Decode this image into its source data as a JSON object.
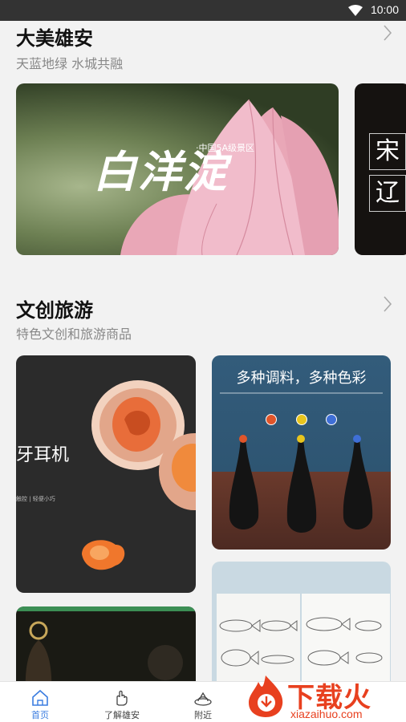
{
  "status_bar": {
    "time": "10:00"
  },
  "sections": {
    "beauty": {
      "title": "大美雄安",
      "subtitle": "天蓝地绿 水城共融"
    },
    "culture": {
      "title": "文创旅游",
      "subtitle": "特色文创和旅游商品"
    }
  },
  "lotus_card": {
    "calligraphy": "白洋淀",
    "tagline": "·中国5A级景区"
  },
  "next_card": {
    "chars": [
      "宋",
      "辽"
    ]
  },
  "products": {
    "earbuds": {
      "headline": "牙耳机",
      "fine_print": "触控 | 轻便小巧"
    },
    "spice": {
      "headline": "多种调料，多种色彩",
      "dot_colors": [
        "#e0552a",
        "#e8c51e",
        "#3f6fd6"
      ]
    }
  },
  "tabs": [
    {
      "label": "首页",
      "icon": "home-icon",
      "active": true
    },
    {
      "label": "了解雄安",
      "icon": "hand-icon",
      "active": false
    },
    {
      "label": "附近",
      "icon": "nearby-icon",
      "active": false
    }
  ],
  "watermark": {
    "main": "下载火",
    "url": "xiazaihuo.com",
    "color": "#e8401f"
  }
}
